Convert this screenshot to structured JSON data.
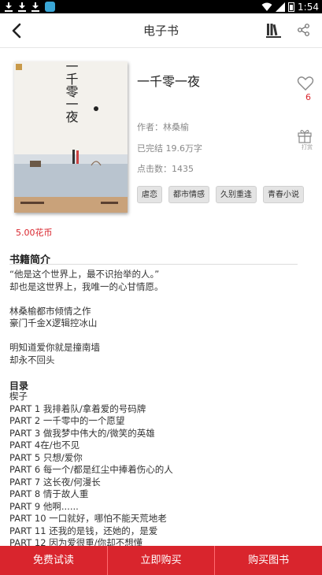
{
  "status_bar": {
    "time": "1:54"
  },
  "header": {
    "title": "电子书"
  },
  "book": {
    "title": "一千零一夜",
    "author": "作者：林桑榆",
    "status": "已完结 19.6万字",
    "clicks": "点击数：1435",
    "tags": [
      "虐恋",
      "都市情感",
      "久别重逢",
      "青春小说"
    ],
    "like_count": "6",
    "gift_label": "打赏",
    "price": "5.00花币",
    "cover_text": {
      "title": "一千零一夜",
      "author": "林桑榆"
    }
  },
  "intro": {
    "heading": "书籍简介",
    "text": "“他是这个世界上，最不识抬举的人。”\n却也是这世界上，我唯一的心甘情愿。\n\n林桑榆都市倾情之作\n豪门千金X逻辑控冰山\n\n明知道爱你就是撞南墙\n却永不回头"
  },
  "toc": {
    "heading": "目录",
    "items": [
      "楔子",
      "PART 1 我排着队/拿着爱的号码牌",
      "PART 2 一千零中的一个愿望",
      "PART 3 做我梦中伟大的/微笑的英雄",
      "PART 4在/也不见",
      "PART 5 只想/爱你",
      "PART 6 每一个/都是红尘中捧着伤心的人",
      "PART 7 这长夜/何漫长",
      "PART 8 情于故人重",
      "PART 9 他啊......",
      "PART 10 一口就好，哪怕不能天荒地老",
      "PART 11 还我的是钱，还她的，是爱",
      "PART 12 因为爱很重/你却不想懂"
    ]
  },
  "bottom_bar": {
    "trial": "免费试读",
    "buy_now": "立即购买",
    "buy_book": "购买图书"
  },
  "colors": {
    "accent": "#d9252d",
    "tag_bg": "#e4e4e4"
  }
}
